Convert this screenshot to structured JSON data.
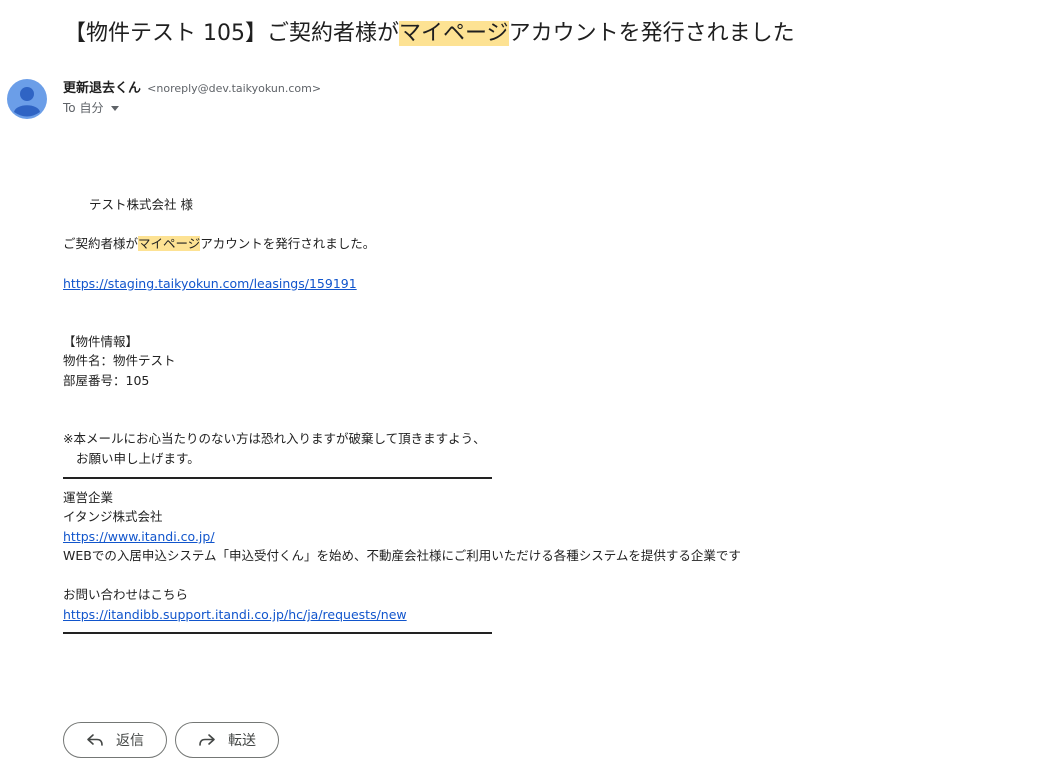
{
  "email": {
    "subject_pre": "【物件テスト 105】ご契約者様が",
    "subject_hl": "マイページ",
    "subject_post": "アカウントを発行されました",
    "sender_name": "更新退去くん",
    "sender_email": "<noreply@dev.taikyokun.com>",
    "recipient": "To 自分"
  },
  "body": {
    "greeting": "テスト株式会社 様",
    "intro_pre": "ご契約者様が",
    "intro_hl": "マイページ",
    "intro_post": "アカウントを発行されました。",
    "link1": "https://staging.taikyokun.com/leasings/159191",
    "info_heading": "【物件情報】",
    "property_name": "物件名：物件テスト",
    "room_number": "部屋番号：105",
    "notice_1": "※本メールにお心当たりのない方は恐れ入りますが破棄して頂きますよう、",
    "notice_2": "お願い申し上げます。",
    "operator_heading": "運営企業",
    "company": "イタンジ株式会社",
    "company_url": "https://www.itandi.co.jp/",
    "company_desc": "WEBでの入居申込システム「申込受付くん」を始め、不動産会社様にご利用いただける各種システムを提供する企業です",
    "contact_label": "お問い合わせはこちら",
    "contact_url": "https://itandibb.support.itandi.co.jp/hc/ja/requests/new"
  },
  "actions": {
    "reply_label": "返信",
    "forward_label": "転送"
  },
  "icons": {
    "avatar": "person-avatar-icon",
    "reply": "reply-arrow-icon",
    "forward": "forward-arrow-icon",
    "caret": "caret-down-icon"
  },
  "colors": {
    "highlight": "#fde293",
    "link": "#1155cc",
    "avatar": "#6b9ee8"
  }
}
